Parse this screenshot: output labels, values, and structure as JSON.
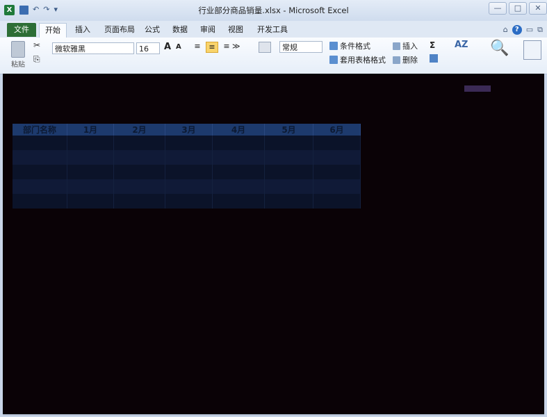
{
  "window": {
    "title": "行业部分商品销量.xlsx - Microsoft Excel",
    "controls": [
      "—",
      "□",
      "✕"
    ]
  },
  "qat": {
    "undo": "↶",
    "redo": "↷",
    "customize": "▾"
  },
  "tabs": [
    {
      "label": "文件"
    },
    {
      "label": "开始"
    },
    {
      "label": "插入"
    },
    {
      "label": "页面布局"
    },
    {
      "label": "公式"
    },
    {
      "label": "数据"
    },
    {
      "label": "审阅"
    },
    {
      "label": "视图"
    },
    {
      "label": "开发工具"
    }
  ],
  "ribbon": {
    "paste_label": "粘贴",
    "font_name": "微软雅黑",
    "font_size": "16",
    "number_format": "常规",
    "conditional_format": "条件格式",
    "table_format": "套用表格格式",
    "insert": "插入",
    "delete": "删除",
    "sigma": "Σ",
    "sort_letters": "AZ",
    "find_glyph": "🔍"
  },
  "sheet": {
    "headers": [
      "部门名称",
      "1月",
      "2月",
      "3月",
      "4月",
      "5月",
      "6月"
    ],
    "row_count": 5
  },
  "colors": {
    "file_tab": "#2d6e36",
    "header_fill": "#1d3a6d",
    "sheet_bg": "#0a0206"
  }
}
